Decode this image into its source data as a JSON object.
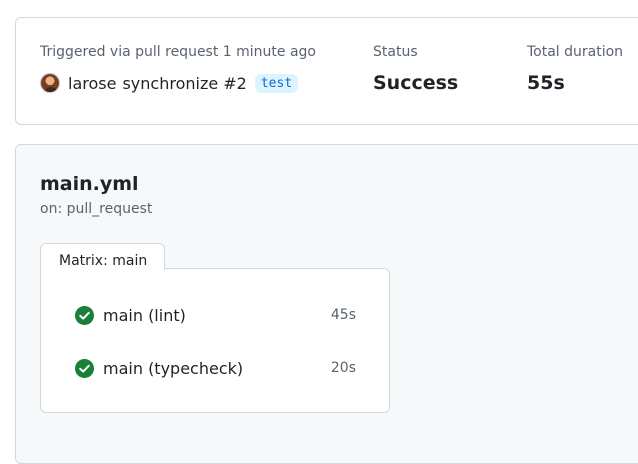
{
  "summary": {
    "trigger_label": "Triggered via pull request 1 minute ago",
    "actor": "larose",
    "event_text": "synchronize #2",
    "branch": "test",
    "status_label": "Status",
    "status_value": "Success",
    "duration_label": "Total duration",
    "duration_value": "55s"
  },
  "workflow": {
    "title": "main.yml",
    "trigger": "on: pull_request",
    "matrix_label": "Matrix: main",
    "jobs": [
      {
        "name": "main (lint)",
        "duration": "45s",
        "status": "success"
      },
      {
        "name": "main (typecheck)",
        "duration": "20s",
        "status": "success"
      }
    ]
  },
  "colors": {
    "success": "#1a7f37",
    "branch_text": "#0969da",
    "branch_bg": "#ddf4ff"
  }
}
